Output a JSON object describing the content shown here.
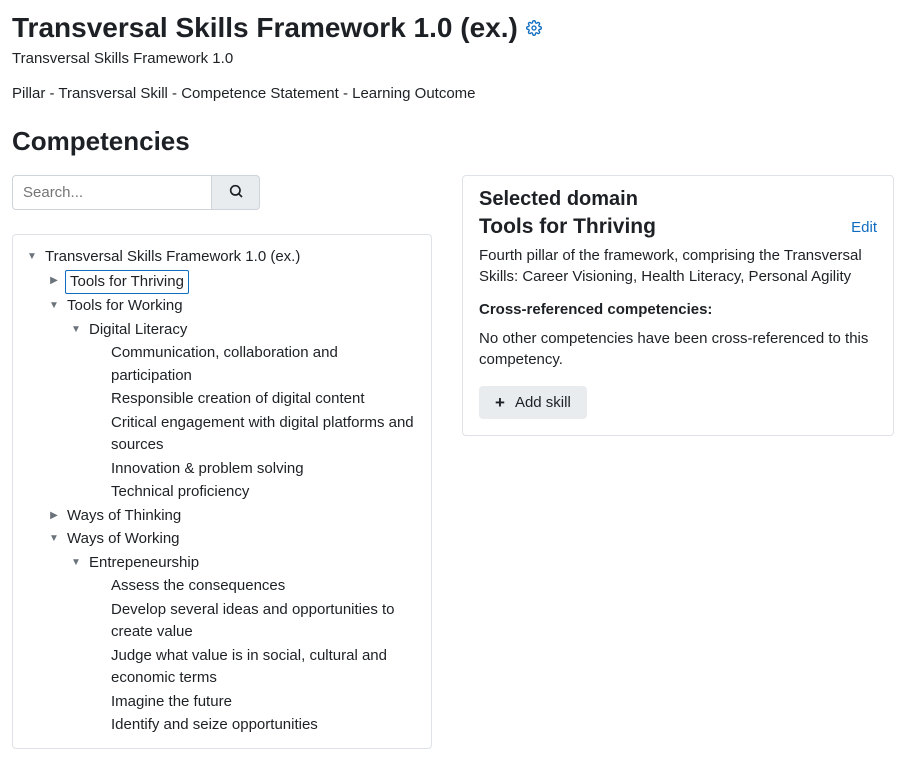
{
  "header": {
    "title": "Transversal Skills Framework 1.0 (ex.)",
    "subtitle": "Transversal Skills Framework 1.0",
    "breadcrumb": "Pillar - Transversal Skill - Competence Statement - Learning Outcome"
  },
  "section_title": "Competencies",
  "search": {
    "placeholder": "Search..."
  },
  "selected_node": "Tools for Thriving",
  "tree": {
    "root": {
      "label": "Transversal Skills Framework 1.0 (ex.)",
      "expanded": true,
      "children": [
        {
          "label": "Tools for Thriving",
          "expanded": false,
          "children": []
        },
        {
          "label": "Tools for Working",
          "expanded": true,
          "children": [
            {
              "label": "Digital Literacy",
              "expanded": true,
              "children": [
                {
                  "label": "Communication, collaboration and participation"
                },
                {
                  "label": "Responsible creation of digital content"
                },
                {
                  "label": "Critical engagement with digital platforms and sources"
                },
                {
                  "label": "Innovation & problem solving"
                },
                {
                  "label": "Technical proficiency"
                }
              ]
            }
          ]
        },
        {
          "label": "Ways of Thinking",
          "expanded": false,
          "children": []
        },
        {
          "label": "Ways of Working",
          "expanded": true,
          "children": [
            {
              "label": "Entrepeneurship",
              "expanded": true,
              "children": [
                {
                  "label": "Assess the consequences"
                },
                {
                  "label": "Develop several ideas and opportunities to create value"
                },
                {
                  "label": "Judge what value is in social, cultural and economic terms"
                },
                {
                  "label": "Imagine the future"
                },
                {
                  "label": "Identify and seize opportunities"
                }
              ]
            }
          ]
        }
      ]
    }
  },
  "detail": {
    "heading": "Selected domain",
    "name": "Tools for Thriving",
    "edit": "Edit",
    "description": "Fourth pillar of the framework, comprising the Transversal Skills: Career Visioning, Health Literacy, Personal Agility",
    "cross_label": "Cross-referenced competencies:",
    "cross_text": "No other competencies have been cross-referenced to this competency.",
    "add_label": "Add skill"
  }
}
